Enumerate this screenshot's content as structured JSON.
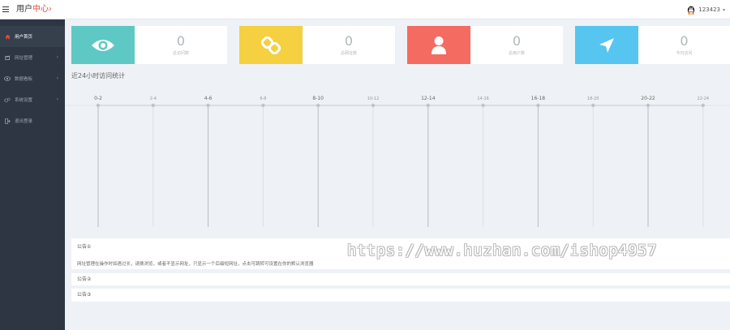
{
  "header": {
    "title_main": "用户",
    "title_accent": "中心",
    "title_suffix": "›",
    "username": "123423",
    "caret": "▾"
  },
  "sidebar": {
    "items": [
      {
        "label": "用户首页",
        "icon": "home-icon",
        "active": true
      },
      {
        "label": "网址管理",
        "icon": "link-icon",
        "has_children": true
      },
      {
        "label": "数据看板",
        "icon": "eye-icon",
        "has_children": true
      },
      {
        "label": "系统设置",
        "icon": "gear-icon",
        "has_children": true
      },
      {
        "label": "退出登录",
        "icon": "logout-icon"
      }
    ],
    "arrow": "›"
  },
  "cards": [
    {
      "value": "0",
      "label": "总访问数",
      "color": "#5ec8c4",
      "icon": "eye-icon"
    },
    {
      "value": "0",
      "label": "总网址数",
      "color": "#f5d040",
      "icon": "link-icon"
    },
    {
      "value": "0",
      "label": "总用户数",
      "color": "#f46b61",
      "icon": "user-icon"
    },
    {
      "value": "0",
      "label": "今日访问",
      "color": "#56c5f0",
      "icon": "location-arrow-icon"
    }
  ],
  "chart_title": "近24小时访问统计",
  "chart_data": {
    "type": "line",
    "title": "近24小时访问统计",
    "categories": [
      "0-2",
      "2-4",
      "4-6",
      "6-8",
      "8-10",
      "10-12",
      "12-14",
      "14-16",
      "16-18",
      "18-20",
      "20-22",
      "22-24"
    ],
    "values": [
      0,
      0,
      0,
      0,
      0,
      0,
      0,
      0,
      0,
      0,
      0,
      0
    ],
    "grid": true
  },
  "notices": [
    {
      "title": "公告①",
      "body": "网址管理在操作时如遇过长，请换浏览，或者不显示网址，只显示一个后缀短网址，点击可跳转可设置在你的默认浏览器"
    },
    {
      "title": "公告②"
    },
    {
      "title": "公告③"
    }
  ],
  "watermark": "https://www.huzhan.com/ishop4957"
}
